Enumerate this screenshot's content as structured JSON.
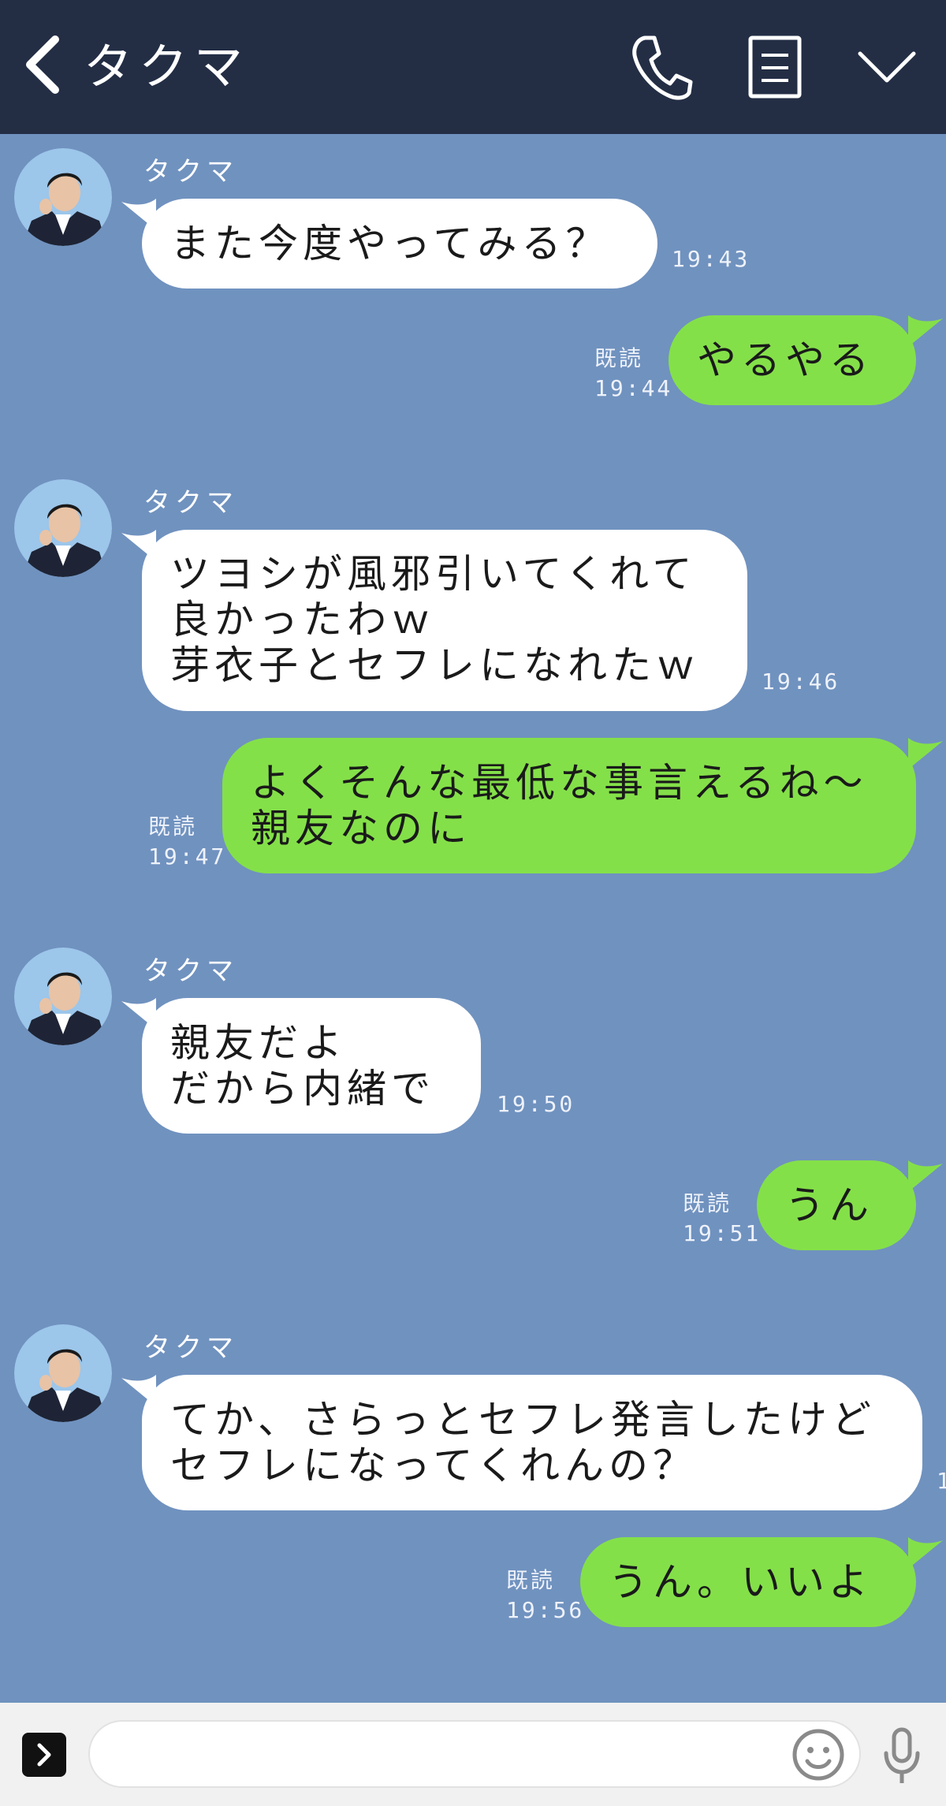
{
  "header": {
    "title": "タクマ",
    "icons": [
      "back-icon",
      "phone-icon",
      "notes-icon",
      "chevron-down-icon"
    ]
  },
  "colors": {
    "header_bg": "#232e45",
    "chat_bg": "#7092bf",
    "incoming_bubble": "#ffffff",
    "outgoing_bubble": "#84e049",
    "footer_bg": "#f1f1f1"
  },
  "messages": [
    {
      "direction": "incoming",
      "sender": "タクマ",
      "text": "また今度やってみる？",
      "time": "19:43"
    },
    {
      "direction": "outgoing",
      "read": "既読",
      "text": "やるやる",
      "time": "19:44"
    },
    {
      "direction": "incoming",
      "sender": "タクマ",
      "text": "ツヨシが風邪引いてくれて\n良かったわｗ\n芽衣子とセフレになれたｗ",
      "time": "19:46"
    },
    {
      "direction": "outgoing",
      "read": "既読",
      "text": "よくそんな最低な事言えるね～\n親友なのに",
      "time": "19:47"
    },
    {
      "direction": "incoming",
      "sender": "タクマ",
      "text": "親友だよ\nだから内緒で",
      "time": "19:50"
    },
    {
      "direction": "outgoing",
      "read": "既読",
      "text": "うん",
      "time": "19:51"
    },
    {
      "direction": "incoming",
      "sender": "タクマ",
      "text": "てか、さらっとセフレ発言したけど\nセフレになってくれんの？",
      "time": "1"
    },
    {
      "direction": "outgoing",
      "read": "既読",
      "text": "うん。いいよ",
      "time": "19:56"
    }
  ],
  "footer": {
    "input_value": "",
    "icons": [
      "expand-icon",
      "emoji-icon",
      "mic-icon"
    ]
  }
}
